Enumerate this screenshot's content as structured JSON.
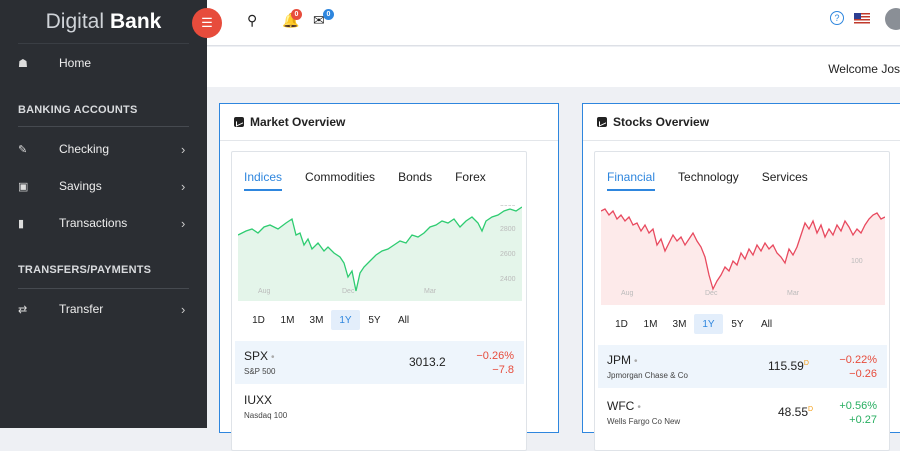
{
  "brand": {
    "light": "Digital",
    "bold": "Bank"
  },
  "sidebar": {
    "home": "Home",
    "section1": "BANKING ACCOUNTS",
    "items1": [
      {
        "label": "Checking"
      },
      {
        "label": "Savings"
      },
      {
        "label": "Transactions"
      }
    ],
    "section2": "TRANSFERS/PAYMENTS",
    "items2": [
      {
        "label": "Transfer"
      }
    ]
  },
  "topbar": {
    "notif_count": "0",
    "mail_count": "0"
  },
  "welcome": "Welcome Jos",
  "market": {
    "title": "Market Overview",
    "tabs": [
      "Indices",
      "Commodities",
      "Bonds",
      "Forex"
    ],
    "axis": {
      "y": [
        "3000",
        "2800",
        "2600",
        "2400"
      ],
      "x": [
        "Aug",
        "Dec",
        "Mar"
      ]
    },
    "ranges": [
      "1D",
      "1M",
      "3M",
      "1Y",
      "5Y",
      "All"
    ],
    "rows": [
      {
        "symbol": "SPX",
        "name": "S&P 500",
        "price": "3013.2",
        "pct": "−0.26%",
        "chg": "−7.8"
      },
      {
        "symbol": "IUXX",
        "name": "Nasdaq 100",
        "price": "",
        "pct": "",
        "chg": ""
      }
    ]
  },
  "stocks": {
    "title": "Stocks Overview",
    "tabs": [
      "Financial",
      "Technology",
      "Services"
    ],
    "axis": {
      "y": [
        "100"
      ],
      "x": [
        "Aug",
        "Dec",
        "Mar"
      ]
    },
    "ranges": [
      "1D",
      "1M",
      "3M",
      "1Y",
      "5Y",
      "All"
    ],
    "rows": [
      {
        "symbol": "JPM",
        "name": "Jpmorgan Chase & Co",
        "price": "115.59",
        "sup": "D",
        "pct": "−0.22%",
        "chg": "−0.26"
      },
      {
        "symbol": "WFC",
        "name": "Wells Fargo Co New",
        "price": "48.55",
        "sup": "D",
        "pct": "+0.56%",
        "chg": "+0.27"
      }
    ]
  },
  "colors": {
    "accent": "#2e86de",
    "red": "#e74c3c",
    "green": "#27ae60",
    "sidebar": "#2b2e33"
  }
}
